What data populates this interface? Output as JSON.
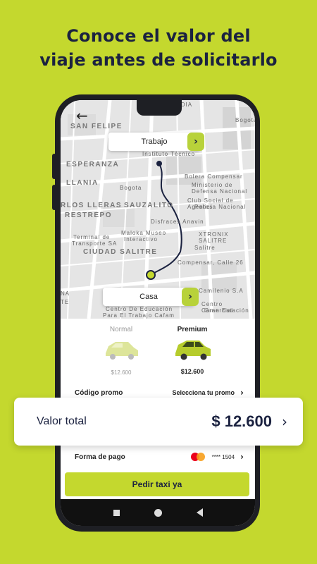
{
  "headline": {
    "line1": "Conoce el valor del",
    "line2": "viaje antes de solicitarlo"
  },
  "map": {
    "origin_label": "Trabajo",
    "destination_label": "Casa",
    "labels": {
      "san_felipe": "SAN FELIPE",
      "esperanza": "ESPERANZA",
      "llania": "LLANIA",
      "carlos_lleras": "RLOS LLERAS",
      "restrepo": "RESTREPO",
      "sauzalito": "SAUZALITO",
      "ciudad_salitre": "CIUDAD SALITRE",
      "mandia": "MANDIA",
      "instituto": "Instituto Técnico",
      "bolera": "Bolera Compensar",
      "ministerio": "Ministerio de",
      "defensa": "Defensa Nacional",
      "club": "Club Social de Agentes",
      "policia": "Policía Nacional",
      "maloka": "Maloka Museo",
      "interactivo": "Interactivo",
      "xtronix": "XTRONIX SALITRE",
      "salitre": "Salitre",
      "terminal": "Terminal de",
      "transporte": "Transporte SA",
      "disfraces": "Disfraces Anavin",
      "compensar": "Compensar, Calle 26",
      "centro_educ": "Centro De Educación",
      "trabajo_cafam": "Para El Trabajo Cafam",
      "centro_com": "Centro Comercial",
      "gran_estacion": "Gran Estación",
      "camilenio": "Camilenio S.A",
      "na": "NA",
      "te": "TE",
      "bogota": "Bogota",
      "bogota2": "Bogotá"
    }
  },
  "options": {
    "normal": {
      "name": "Normal",
      "price": "$12.600"
    },
    "premium": {
      "name": "Premium",
      "price": "$12.600"
    }
  },
  "promo": {
    "label": "Código promo",
    "action": "Selecciona tu promo"
  },
  "payment": {
    "label": "Forma de pago",
    "card_masked": "**** 1504"
  },
  "cta_label": "Pedir taxi ya",
  "total": {
    "label": "Valor total",
    "value": "$ 12.600"
  },
  "colors": {
    "accent": "#c4d82e",
    "navy": "#1b2240"
  }
}
